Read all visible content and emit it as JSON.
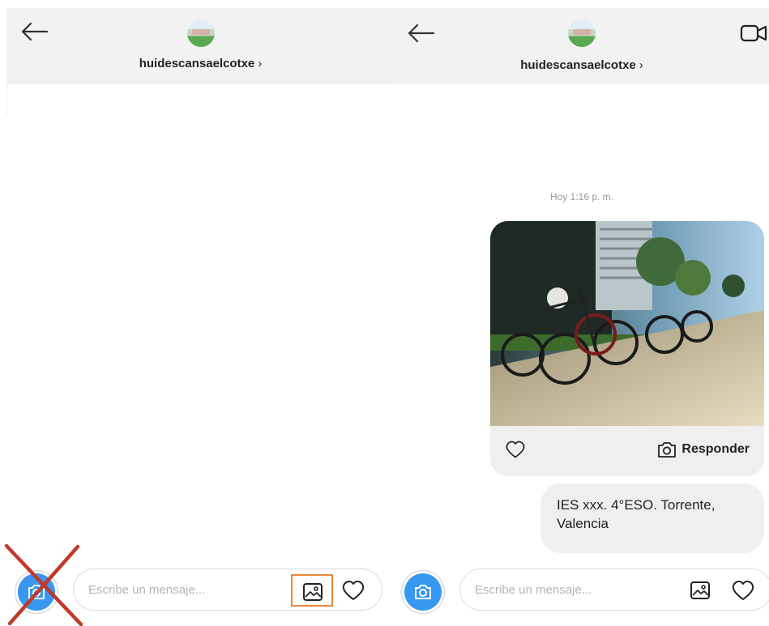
{
  "left_screen": {
    "username": "huidescansaelcotxe",
    "username_chevron": "›",
    "composer": {
      "placeholder": "Escribe un mensaje..."
    }
  },
  "right_screen": {
    "username": "huidescansaelcotxe",
    "username_chevron": "›",
    "timestamp": "Hoy 1:16 p. m.",
    "photo_message": {
      "reply_label": "Responder"
    },
    "text_message": "IES xxx. 4°ESO. Torrente, Valencia",
    "composer": {
      "placeholder": "Escribe un mensaje..."
    }
  },
  "icons": {
    "back": "arrow-left-icon",
    "video": "video-camera-icon",
    "camera": "camera-icon",
    "gallery": "image-gallery-icon",
    "heart": "heart-outline-icon",
    "cross": "red-x-mark"
  },
  "colors": {
    "camera_button": "#3897f0",
    "highlight_border": "#e8873a",
    "cross_mark": "#c0392b",
    "header_bg": "#f2f2f2",
    "bubble_bg": "#efefef"
  }
}
